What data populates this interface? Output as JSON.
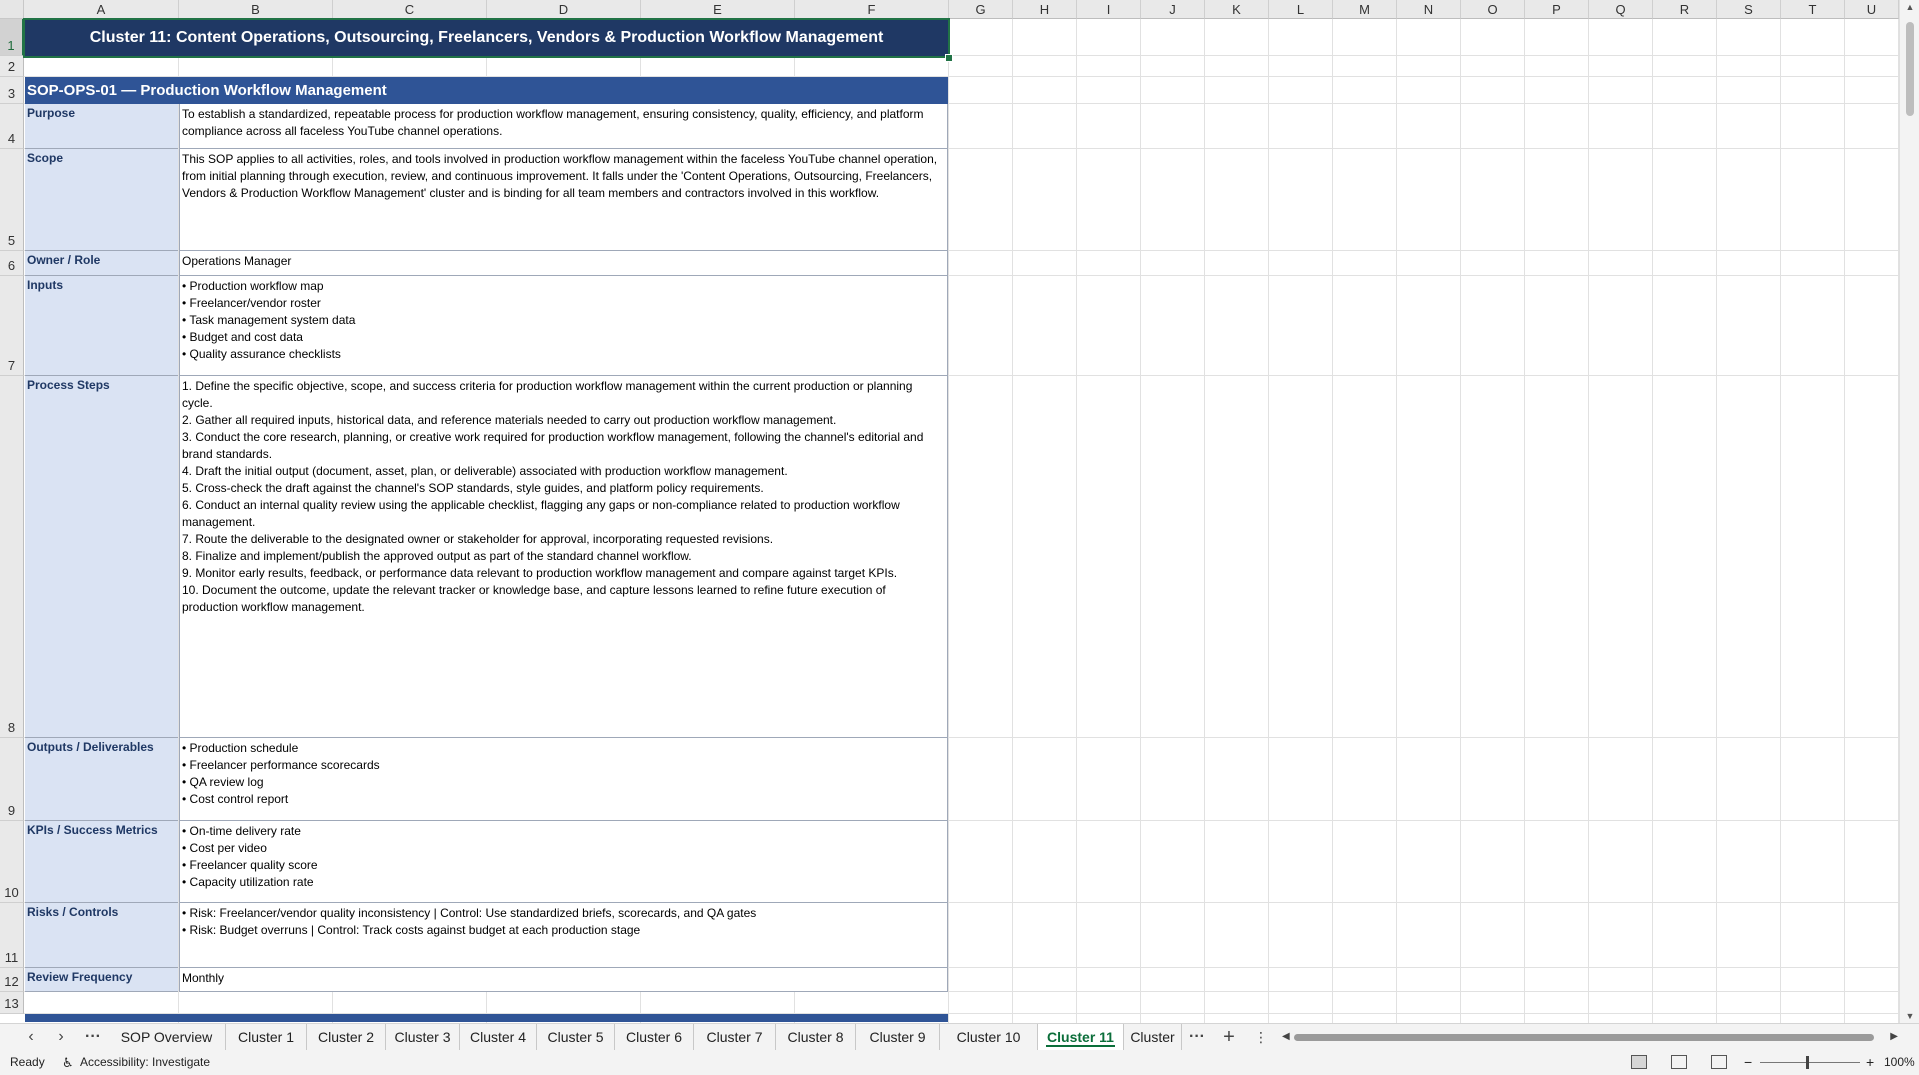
{
  "columns": [
    "A",
    "B",
    "C",
    "D",
    "E",
    "F",
    "G",
    "H",
    "I",
    "J",
    "K",
    "L",
    "M",
    "N",
    "O",
    "P",
    "Q",
    "R",
    "S",
    "T",
    "U"
  ],
  "rows": [
    "1",
    "2",
    "3",
    "4",
    "5",
    "6",
    "7",
    "8",
    "9",
    "10",
    "11",
    "12",
    "13"
  ],
  "title": "Cluster 11: Content Operations, Outsourcing, Freelancers, Vendors & Production Workflow Management",
  "sop_header": "SOP-OPS-01  —  Production Workflow Management",
  "fields": [
    {
      "label": "Purpose",
      "value": "To establish a standardized, repeatable process for production workflow management, ensuring consistency, quality, efficiency, and platform compliance across all faceless YouTube channel operations."
    },
    {
      "label": "Scope",
      "value": "This SOP applies to all activities, roles, and tools involved in production workflow management within the faceless YouTube channel operation, from initial planning through execution, review, and continuous improvement. It falls under the 'Content Operations, Outsourcing, Freelancers, Vendors & Production Workflow Management' cluster and is binding for all team members and contractors involved in this workflow."
    },
    {
      "label": "Owner / Role",
      "value": "Operations Manager"
    },
    {
      "label": "Inputs",
      "value": "• Production workflow map\n• Freelancer/vendor roster\n• Task management system data\n• Budget and cost data\n• Quality assurance checklists"
    },
    {
      "label": "Process Steps",
      "value": "1. Define the specific objective, scope, and success criteria for production workflow management within the current production or planning cycle.\n2. Gather all required inputs, historical data, and reference materials needed to carry out production workflow management.\n3. Conduct the core research, planning, or creative work required for production workflow management, following the channel's editorial and brand standards.\n4. Draft the initial output (document, asset, plan, or deliverable) associated with production workflow management.\n5. Cross-check the draft against the channel's SOP standards, style guides, and platform policy requirements.\n6. Conduct an internal quality review using the applicable checklist, flagging any gaps or non-compliance related to production workflow management.\n7. Route the deliverable to the designated owner or stakeholder for approval, incorporating requested revisions.\n8. Finalize and implement/publish the approved output as part of the standard channel workflow.\n9. Monitor early results, feedback, or performance data relevant to production workflow management and compare against target KPIs.\n10. Document the outcome, update the relevant tracker or knowledge base, and capture lessons learned to refine future execution of production workflow management."
    },
    {
      "label": "Outputs / Deliverables",
      "value": "• Production schedule\n• Freelancer performance scorecards\n• QA review log\n• Cost control report"
    },
    {
      "label": "KPIs / Success Metrics",
      "value": "• On-time delivery rate\n• Cost per video\n• Freelancer quality score\n• Capacity utilization rate"
    },
    {
      "label": "Risks / Controls",
      "value": "• Risk: Freelancer/vendor quality inconsistency | Control: Use standardized briefs, scorecards, and QA gates\n• Risk: Budget overruns | Control: Track costs against budget at each production stage"
    },
    {
      "label": "Review Frequency",
      "value": "Monthly"
    }
  ],
  "tabs": [
    "SOP Overview",
    "Cluster 1",
    "Cluster 2",
    "Cluster 3",
    "Cluster 4",
    "Cluster 5",
    "Cluster 6",
    "Cluster 7",
    "Cluster 8",
    "Cluster 9",
    "Cluster 10",
    "Cluster 11",
    "Cluster"
  ],
  "active_tab": "Cluster 11",
  "status": {
    "ready": "Ready",
    "accessibility": "Accessibility: Investigate",
    "zoom": "100%"
  },
  "colors": {
    "title_bg": "#1f3864",
    "header_bg": "#2f5496",
    "label_bg": "#dae3f3",
    "accent": "#217346"
  }
}
